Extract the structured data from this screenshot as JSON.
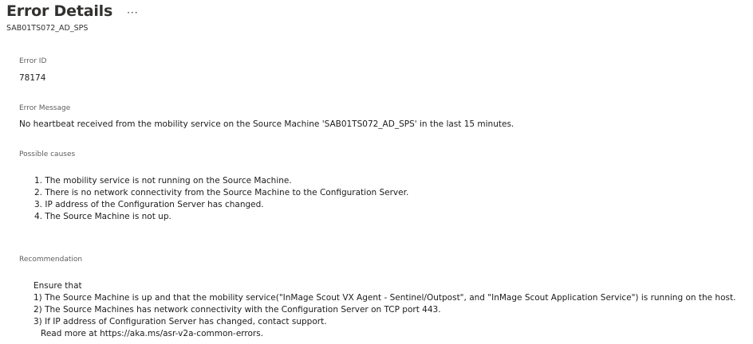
{
  "header": {
    "title": "Error Details",
    "more_label": "···",
    "subtitle": "SAB01TS072_AD_SPS"
  },
  "error_id": {
    "label": "Error ID",
    "value": "78174"
  },
  "error_message": {
    "label": "Error Message",
    "value": "No heartbeat received from the mobility service on the Source Machine 'SAB01TS072_AD_SPS' in the last 15 minutes."
  },
  "possible_causes": {
    "label": "Possible causes",
    "items": [
      "1. The mobility service is not running on the Source Machine.",
      "2. There is no network connectivity from the Source Machine to the Configuration Server.",
      "3. IP address of the Configuration Server has changed.",
      "4. The Source Machine is not up."
    ]
  },
  "recommendation": {
    "label": "Recommendation",
    "intro": "Ensure that",
    "items": [
      "1) The Source Machine is up and that the mobility service(\"InMage Scout VX Agent - Sentinel/Outpost\", and  \"InMage Scout Application Service\") is running on the host.",
      "2) The Source Machines has network connectivity with the Configuration Server on TCP port 443.",
      "3) If IP address of Configuration Server has changed, contact support."
    ],
    "read_more": "Read more at https://aka.ms/asr-v2a-common-errors."
  }
}
